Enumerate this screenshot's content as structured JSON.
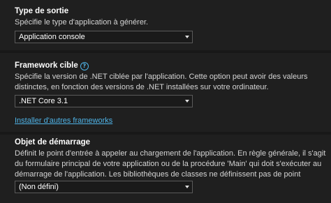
{
  "output_type": {
    "title": "Type de sortie",
    "description": "Spécifie le type d'application à générer.",
    "selected": "Application console"
  },
  "target_framework": {
    "title": "Framework cible",
    "help_icon": "?",
    "description": "Spécifie la version de .NET ciblée par l'application. Cette option peut avoir des valeurs distinctes, en fonction des versions de .NET installées sur votre ordinateur.",
    "selected": ".NET Core 3.1",
    "link": "Installer d'autres frameworks"
  },
  "startup_object": {
    "title": "Objet de démarrage",
    "description": "Définit le point d'entrée à appeler au chargement de l'application. En règle générale, il s'agit du formulaire principal de votre application ou de la procédure 'Main' qui doit s'exécuter au démarrage de l'application. Les bibliothèques de classes ne définissent pas de point d'entrée.",
    "selected": "(Non défini)"
  }
}
